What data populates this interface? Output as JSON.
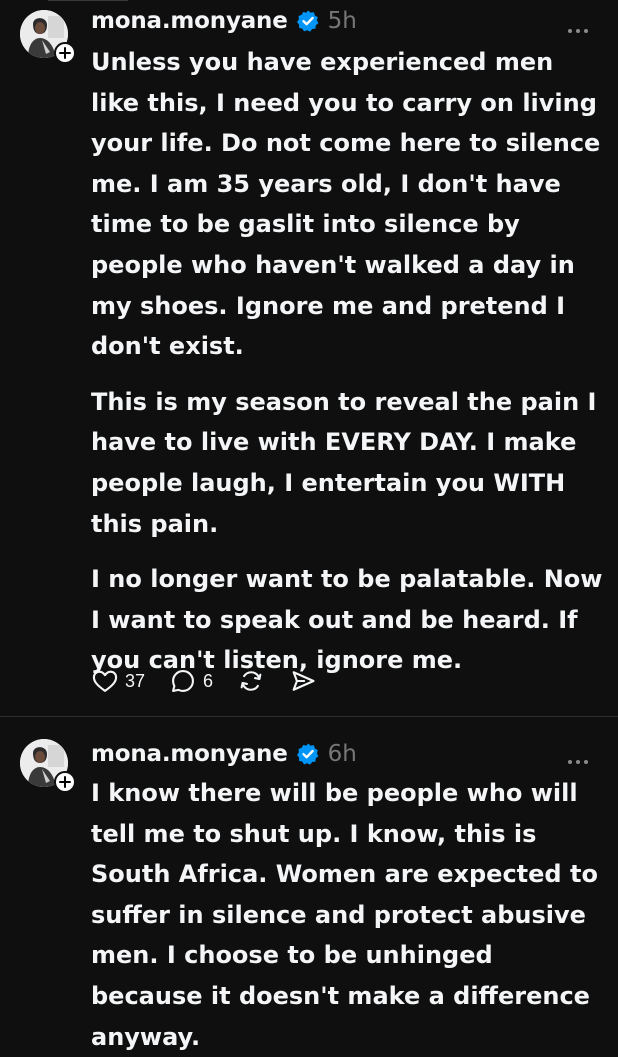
{
  "colors": {
    "background": "#0f0f0f",
    "text": "#f3f5f7",
    "muted": "#777777",
    "verified": "#0095f6",
    "divider": "#2e2e2e"
  },
  "posts": [
    {
      "username": "mona.monyane",
      "time": "5h",
      "verified_icon": "verified-badge-icon",
      "paragraphs": [
        "Unless you have experienced men like this, I need you to carry on living your life. Do not come here to silence me. I am 35 years old, I don't have time to be gaslit into silence by people who haven't walked a day in my shoes. Ignore me and pretend I don't exist.",
        "This is my season to reveal the pain I have to live with EVERY DAY. I make people laugh, I entertain you WITH this pain.",
        "I no longer want to be palatable. Now I want to speak out and be heard. If you can't listen, ignore me."
      ],
      "actions": {
        "like_icon": "heart-icon",
        "like_count": "37",
        "reply_icon": "comment-icon",
        "reply_count": "6",
        "repost_icon": "repost-icon",
        "share_icon": "send-icon"
      }
    },
    {
      "username": "mona.monyane",
      "time": "6h",
      "verified_icon": "verified-badge-icon",
      "paragraphs": [
        "I know there will be people who will tell me to shut up. I know, this is South Africa. Women are expected to suffer in silence and protect abusive men. I choose to be unhinged because it doesn't make a difference anyway."
      ]
    }
  ]
}
